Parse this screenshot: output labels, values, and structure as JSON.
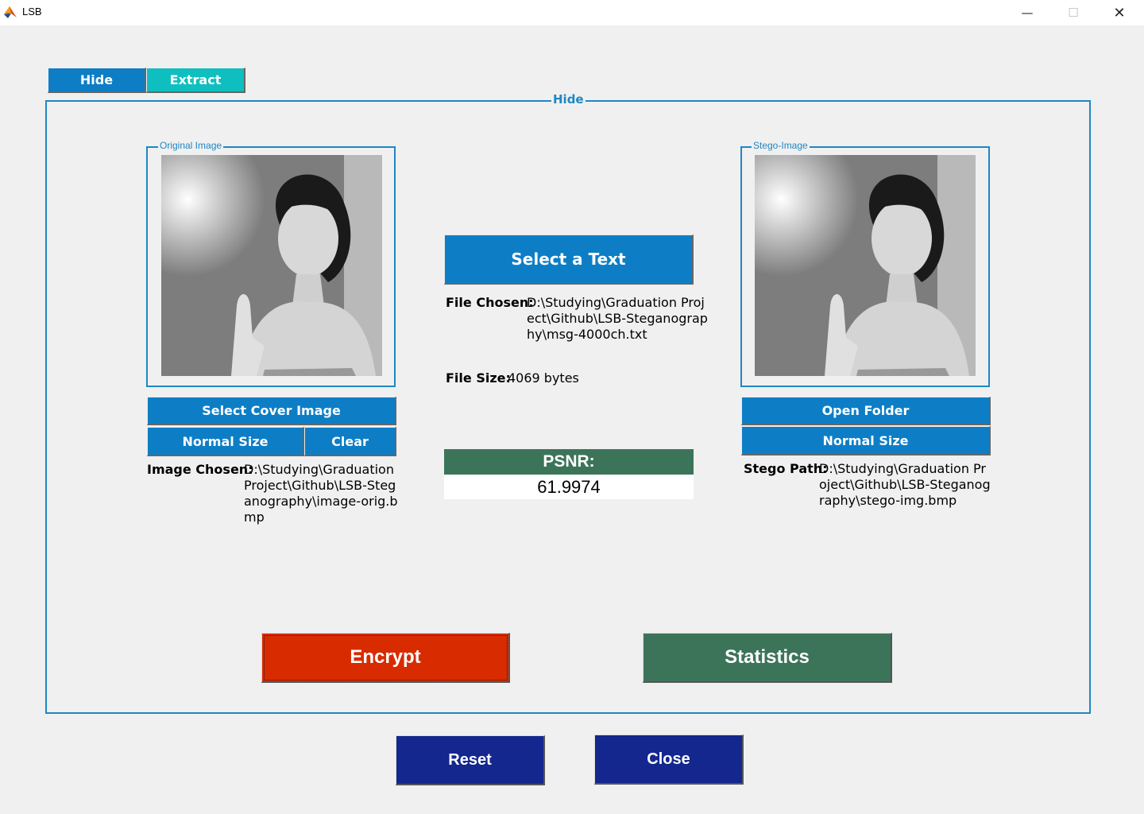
{
  "window": {
    "title": "LSB"
  },
  "tabs": [
    {
      "label": "Hide"
    },
    {
      "label": "Extract"
    }
  ],
  "hide_panel": {
    "title": "Hide",
    "original": {
      "title": "Original Image",
      "select_button": "Select Cover Image",
      "normal_size_button": "Normal Size",
      "clear_button": "Clear",
      "chosen_label": "Image Chosen:",
      "chosen_value": "D:\\Studying\\Graduation Project\\Github\\LSB-Steganography\\image-orig.bmp"
    },
    "text": {
      "select_button": "Select a Text",
      "file_chosen_label": "File Chosen:",
      "file_chosen_value": "D:\\Studying\\Graduation Project\\Github\\LSB-Steganography\\msg-4000ch.txt",
      "file_size_label": "File Size:",
      "file_size_value": "4069 bytes"
    },
    "psnr": {
      "label": "PSNR:",
      "value": "61.9974"
    },
    "stego": {
      "title": "Stego-Image",
      "open_folder_button": "Open Folder",
      "normal_size_button": "Normal Size",
      "path_label": "Stego Path:",
      "path_value": "D:\\Studying\\Graduation Project\\Github\\LSB-Steganography\\stego-img.bmp"
    },
    "encrypt_button": "Encrypt",
    "statistics_button": "Statistics"
  },
  "footer": {
    "reset_button": "Reset",
    "close_button": "Close"
  },
  "colors": {
    "tab_active": "#0d7ec6",
    "tab_inactive": "#0fbfbf",
    "panel_border": "#1e87c4",
    "encrypt": "#d82b00",
    "statistics": "#3c745a",
    "footer_buttons": "#14278e"
  }
}
